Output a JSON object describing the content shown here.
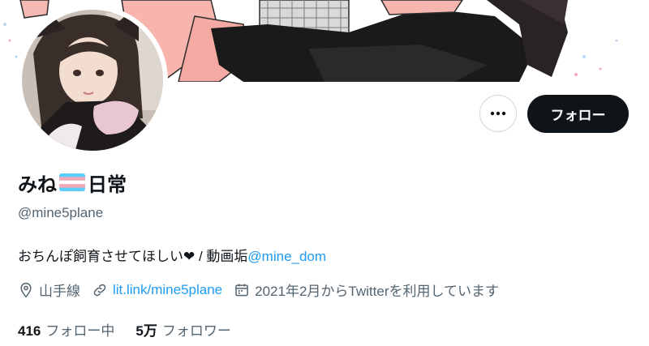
{
  "profile": {
    "name_part1": "みね",
    "name_part2": "日常",
    "flag_icon": "transgender-flag",
    "handle": "@mine5plane",
    "bio_text": "おちんぽ飼育させてほしい❤ / 動画垢",
    "bio_mention": "@mine_dom",
    "location": "山手線",
    "link": "lit.link/mine5plane",
    "joined": "2021年2月からTwitterを利用しています",
    "following_count": "416",
    "following_label": "フォロー中",
    "followers_count": "5万",
    "followers_label": "フォロワー"
  },
  "actions": {
    "more_icon": "more-dots-icon",
    "follow_label": "フォロー"
  },
  "colors": {
    "text": "#0f1419",
    "muted": "#536471",
    "link": "#1d9bf0",
    "button_dark": "#0f1419",
    "border": "#cfd9de"
  }
}
